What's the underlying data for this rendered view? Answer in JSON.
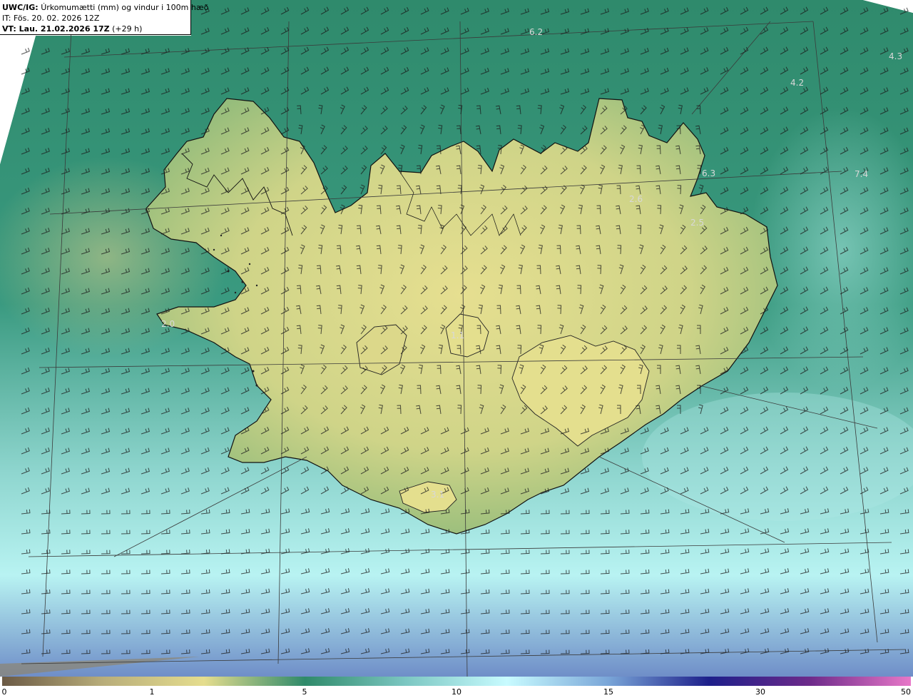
{
  "header": {
    "model": "UWC/IG:",
    "title": "Úrkomumætti (mm) og vindur i 100m hæð",
    "initial_time": "IT: Fös. 20. 02. 2026 12Z",
    "valid_prefix": "VT: Lau. 21.02.2026 17Z",
    "valid_suffix": "(+29 h)"
  },
  "map_labels": [
    {
      "text": "6.2"
    },
    {
      "text": "4.3"
    },
    {
      "text": "4.2"
    },
    {
      "text": "6.3"
    },
    {
      "text": "7.4"
    },
    {
      "text": "2.6"
    },
    {
      "text": "2.5"
    },
    {
      "text": "2.0"
    },
    {
      "text": "1.1"
    },
    {
      "text": "3.1"
    }
  ],
  "colorbar": {
    "ticks": [
      "0",
      "1",
      "5",
      "10",
      "15",
      "30",
      "50"
    ],
    "colors": [
      "#6b5a45",
      "#b8ad7a",
      "#e5dd8e",
      "#2f8a6a",
      "#7cc7c2",
      "#c8fbff",
      "#7aa6d8",
      "#1d1f8a",
      "#6d2a8a",
      "#e878c8"
    ]
  },
  "colors": {
    "land_light": "#e2dd8c",
    "land_mid": "#9cc07c",
    "sea_green": "#2e8a70",
    "sea_cyan": "#9de6e4",
    "sea_blue": "#6e9fd3",
    "graticule": "#3a3a3a"
  }
}
